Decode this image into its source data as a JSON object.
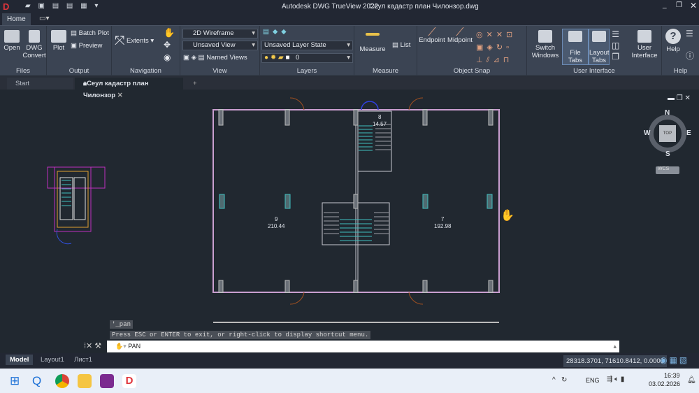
{
  "app": {
    "title": "Autodesk DWG TrueView 2022",
    "file": "Сеул кадастр план Чилонзор.dwg"
  },
  "ribbon_tabs": [
    "Home"
  ],
  "ribbon": {
    "files": {
      "label": "Files",
      "open": "Open",
      "convert": "DWG Convert"
    },
    "output": {
      "label": "Output",
      "plot": "Plot",
      "batch": "Batch Plot",
      "preview": "Preview"
    },
    "navigation": {
      "label": "Navigation",
      "extents": "Extents"
    },
    "view": {
      "label": "View",
      "visual_style": "2D Wireframe",
      "named_view": "Unsaved View",
      "named_views": "Named Views"
    },
    "layers": {
      "label": "Layers",
      "layer_state": "Unsaved Layer State",
      "layer": "0"
    },
    "measure": {
      "label": "Measure",
      "measure": "Measure",
      "list": "List"
    },
    "osnap": {
      "label": "Object Snap",
      "endpoint": "Endpoint",
      "midpoint": "Midpoint"
    },
    "ui": {
      "label": "User Interface",
      "switch": "Switch Windows",
      "filetabs": "File Tabs",
      "layouttabs": "Layout Tabs",
      "userui": "User Interface"
    },
    "help": {
      "label": "Help",
      "help": "Help"
    }
  },
  "file_tabs": {
    "start": "Start",
    "active": "Сеул кадастр план Чилонзор",
    "add": "+"
  },
  "drawing": {
    "rooms": [
      {
        "num": "9",
        "area": "210.44"
      },
      {
        "num": "7",
        "area": "192.98"
      },
      {
        "num": "8",
        "area": "14.57"
      }
    ]
  },
  "viewcube": {
    "n": "N",
    "s": "S",
    "e": "E",
    "w": "W",
    "top": "TOP",
    "wcs": "WCS"
  },
  "command": {
    "history": [
      "'_pan",
      "Press ESC or ENTER to exit, or right-click to display shortcut menu."
    ],
    "current": "PAN"
  },
  "layout_tabs": [
    "Model",
    "Layout1",
    "Лист1"
  ],
  "status": {
    "coords": "28318.3701, 71610.8412, 0.0000"
  },
  "taskbar": {
    "lang": "ENG",
    "time": "16:39",
    "date": "03.02.2026"
  }
}
